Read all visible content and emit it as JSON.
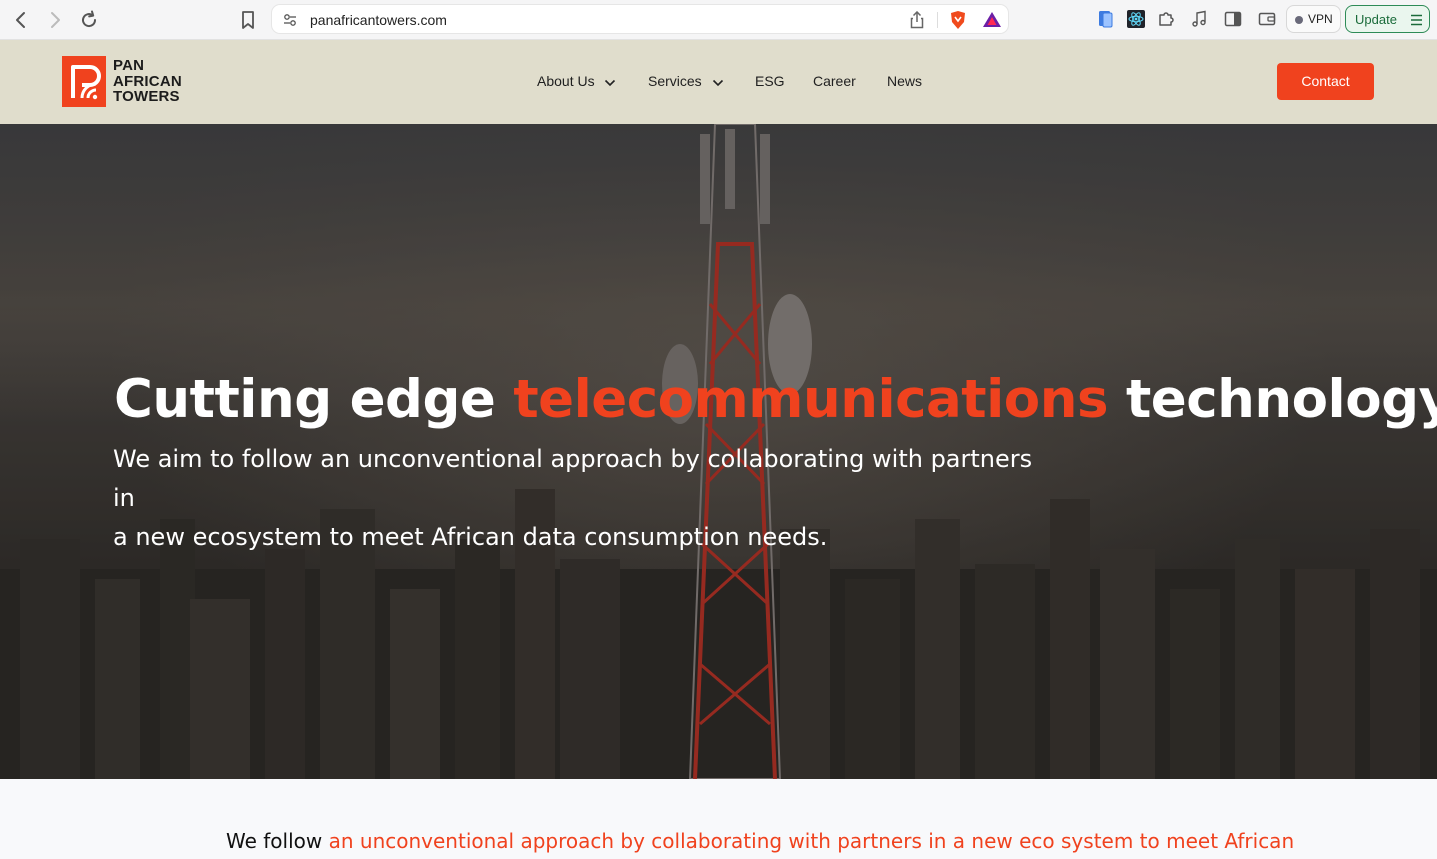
{
  "browser": {
    "url": "panafricantowers.com",
    "vpn_label": "VPN",
    "update_label": "Update",
    "icons": [
      "back-arrow-icon",
      "forward-arrow-icon",
      "reload-icon",
      "bookmark-icon",
      "site-settings-icon",
      "share-icon",
      "brave-shields-icon",
      "brave-rewards-icon",
      "wallet-extension-icon",
      "react-devtools-icon",
      "extensions-puzzle-icon",
      "music-icon",
      "sidebar-icon",
      "wallet-icon",
      "menu-icon"
    ]
  },
  "header": {
    "logo_lines": [
      "PAN",
      "AFRICAN",
      "TOWERS"
    ],
    "nav": [
      {
        "label": "About Us",
        "has_dropdown": true
      },
      {
        "label": "Services",
        "has_dropdown": true
      },
      {
        "label": "ESG",
        "has_dropdown": false
      },
      {
        "label": "Career",
        "has_dropdown": false
      },
      {
        "label": "News",
        "has_dropdown": false
      }
    ],
    "contact_label": "Contact"
  },
  "hero": {
    "title_start": "Cutting edge ",
    "title_highlight": "telecommunications",
    "title_end": " technology.",
    "subtitle_line1": "We aim to follow an unconventional approach by collaborating with partners in",
    "subtitle_line2": "a new ecosystem to meet African data consumption needs."
  },
  "intro": {
    "prefix": "We follow ",
    "highlight": "an unconventional approach by collaborating with partners in a new eco system to meet African"
  },
  "colors": {
    "brand_orange": "#f0421e",
    "header_bg": "#e0ddcc",
    "update_green": "#2e8b57"
  }
}
